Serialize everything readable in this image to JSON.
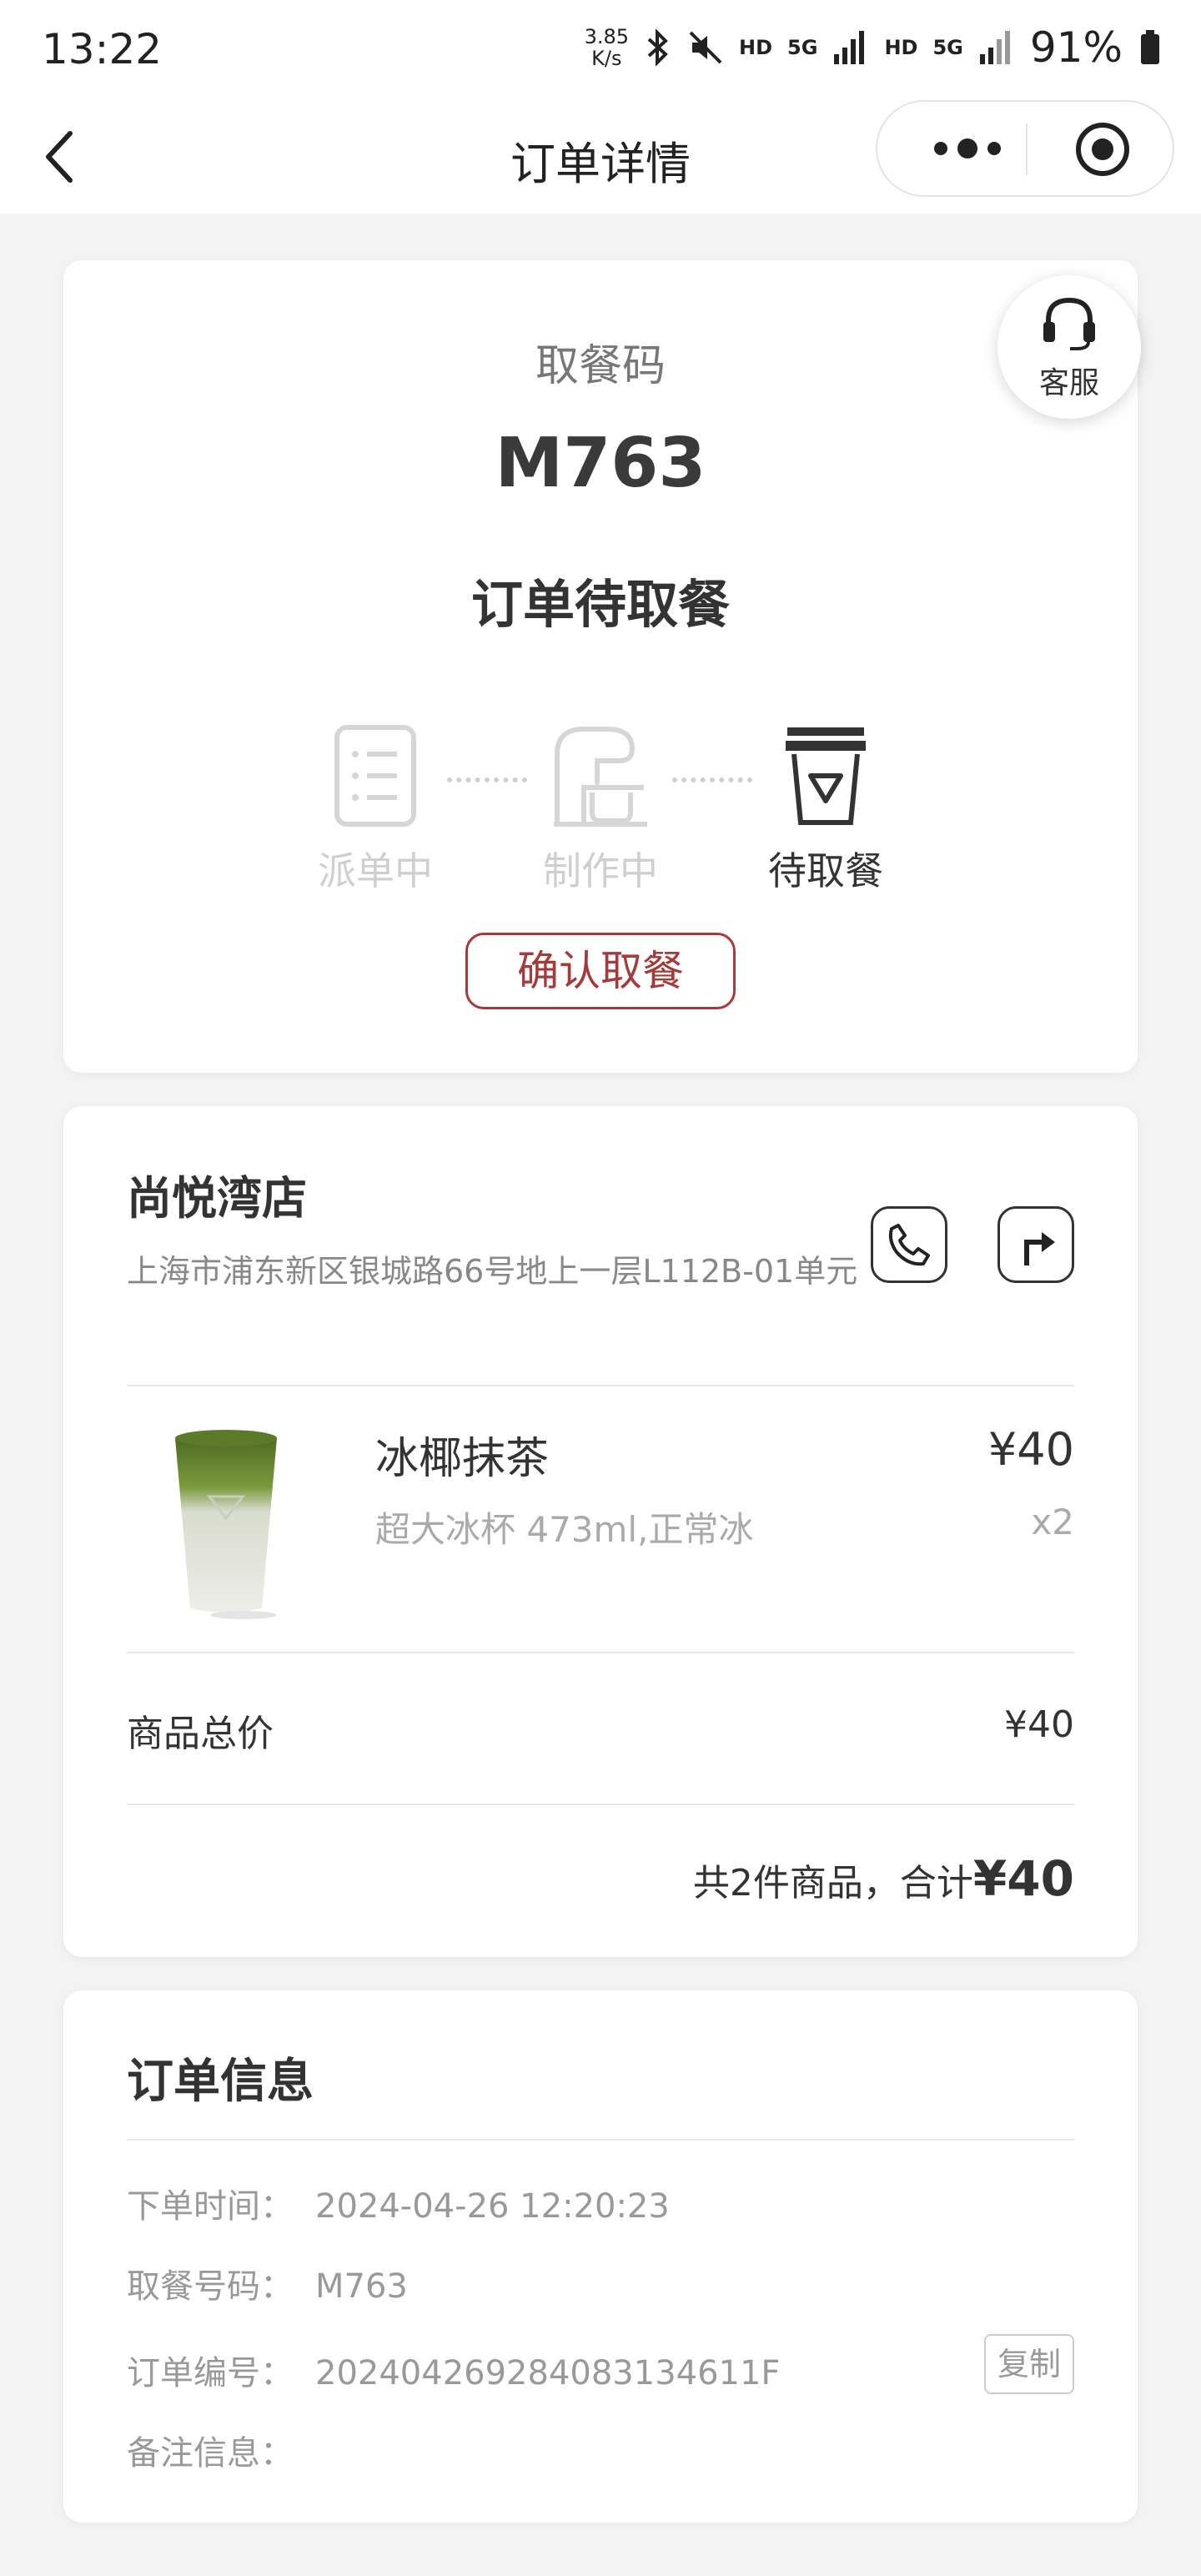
{
  "status_bar": {
    "time": "13:22",
    "net_speed_value": "3.85",
    "net_speed_unit": "K/s",
    "hd1": "HD",
    "sig1": "5G",
    "hd2": "HD",
    "sig2": "5G",
    "battery": "91%"
  },
  "nav": {
    "title": "订单详情"
  },
  "pickup": {
    "label": "取餐码",
    "code": "M763",
    "status": "订单待取餐",
    "steps": [
      {
        "label": "派单中",
        "active": false
      },
      {
        "label": "制作中",
        "active": false
      },
      {
        "label": "待取餐",
        "active": true
      }
    ],
    "confirm_label": "确认取餐",
    "service_label": "客服"
  },
  "store": {
    "name": "尚悦湾店",
    "address": "上海市浦东新区银城路66号地上一层L112B-01单元"
  },
  "product": {
    "name": "冰椰抹茶",
    "spec": "超大冰杯 473ml,正常冰",
    "price": "¥40",
    "qty": "x2"
  },
  "totals": {
    "subtotal_label": "商品总价",
    "subtotal_value": "¥40",
    "summary_prefix": "共2件商品，合计",
    "summary_total": "¥40"
  },
  "order_info": {
    "title": "订单信息",
    "rows": [
      {
        "key": "下单时间：",
        "value": "2024-04-26 12:20:23"
      },
      {
        "key": "取餐号码：",
        "value": "M763"
      },
      {
        "key": "订单编号：",
        "value": "20240426928408313461‌1F"
      },
      {
        "key": "备注信息：",
        "value": ""
      }
    ],
    "copy_label": "复制"
  },
  "colors": {
    "accent": "#a53a3a",
    "matcha": "#5a7a2e"
  }
}
